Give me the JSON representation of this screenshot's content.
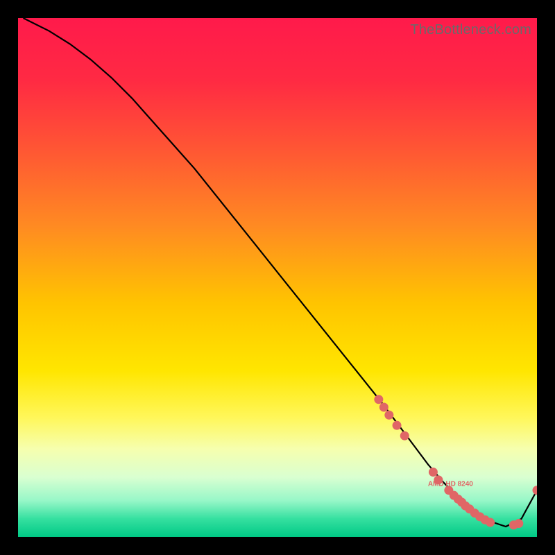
{
  "watermark": "TheBottleneck.com",
  "colors": {
    "background": "#000000",
    "curve": "#000000",
    "marker_fill": "#e06666",
    "marker_stroke": "#e06666",
    "gradient_stops": [
      {
        "offset": 0.0,
        "color": "#ff1a4b"
      },
      {
        "offset": 0.12,
        "color": "#ff2a43"
      },
      {
        "offset": 0.25,
        "color": "#ff5534"
      },
      {
        "offset": 0.4,
        "color": "#ff8a22"
      },
      {
        "offset": 0.55,
        "color": "#ffc400"
      },
      {
        "offset": 0.68,
        "color": "#ffe600"
      },
      {
        "offset": 0.77,
        "color": "#fff75a"
      },
      {
        "offset": 0.83,
        "color": "#f6ffae"
      },
      {
        "offset": 0.885,
        "color": "#d9ffd1"
      },
      {
        "offset": 0.93,
        "color": "#97f7c8"
      },
      {
        "offset": 0.965,
        "color": "#35e0a0"
      },
      {
        "offset": 1.0,
        "color": "#00c985"
      }
    ]
  },
  "chart_data": {
    "type": "line",
    "title": "",
    "xlabel": "",
    "ylabel": "",
    "xlim": [
      0,
      100
    ],
    "ylim": [
      0,
      100
    ],
    "series": [
      {
        "name": "bottleneck-curve",
        "x": [
          1,
          3,
          6,
          10,
          14,
          18,
          22,
          26,
          30,
          34,
          38,
          42,
          46,
          50,
          54,
          58,
          62,
          66,
          70,
          73,
          76,
          79,
          82,
          85,
          88,
          91,
          94,
          97,
          100
        ],
        "y": [
          100,
          99,
          97.5,
          95,
          92,
          88.5,
          84.5,
          80,
          75.5,
          71,
          66,
          61,
          56,
          51,
          46,
          41,
          36,
          31,
          26,
          22,
          18,
          14,
          10.5,
          7.5,
          5,
          3,
          2,
          3.5,
          9
        ]
      }
    ],
    "markers": [
      {
        "x": 69.5,
        "y": 26.5,
        "label": ""
      },
      {
        "x": 70.5,
        "y": 25.0,
        "label": ""
      },
      {
        "x": 71.5,
        "y": 23.5,
        "label": ""
      },
      {
        "x": 73.0,
        "y": 21.5,
        "label": ""
      },
      {
        "x": 74.5,
        "y": 19.5,
        "label": ""
      },
      {
        "x": 80.0,
        "y": 12.5,
        "label": ""
      },
      {
        "x": 81.0,
        "y": 11.0,
        "label": ""
      },
      {
        "x": 83.0,
        "y": 9.0,
        "label": "AMD HD 8240"
      },
      {
        "x": 84.0,
        "y": 8.0,
        "label": ""
      },
      {
        "x": 84.8,
        "y": 7.3,
        "label": ""
      },
      {
        "x": 85.5,
        "y": 6.7,
        "label": ""
      },
      {
        "x": 86.2,
        "y": 6.0,
        "label": ""
      },
      {
        "x": 87.0,
        "y": 5.4,
        "label": ""
      },
      {
        "x": 88.0,
        "y": 4.6,
        "label": ""
      },
      {
        "x": 89.0,
        "y": 3.9,
        "label": ""
      },
      {
        "x": 90.0,
        "y": 3.3,
        "label": ""
      },
      {
        "x": 91.0,
        "y": 2.8,
        "label": ""
      },
      {
        "x": 95.5,
        "y": 2.3,
        "label": ""
      },
      {
        "x": 96.5,
        "y": 2.6,
        "label": ""
      },
      {
        "x": 100.0,
        "y": 9.0,
        "label": ""
      }
    ],
    "marker_label_visible": "AMD HD 8240"
  }
}
